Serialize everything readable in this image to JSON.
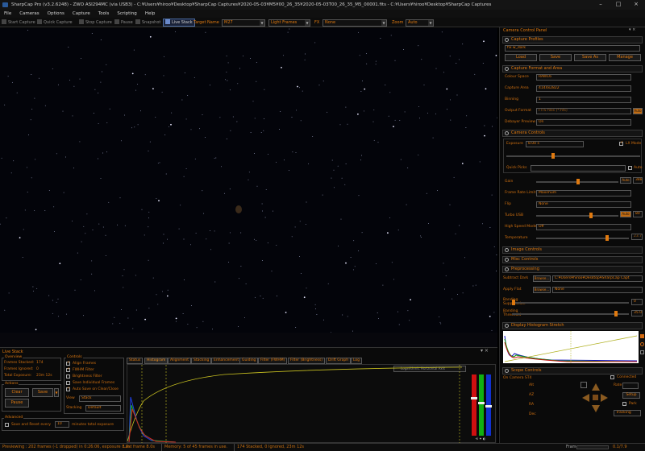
{
  "window": {
    "title": "SharpCap Pro (v3.2.6248) - ZWO ASI294MC (via USB3) - C:¥Users¥hiroo¥Desktop¥SharpCap Captures¥2020-05-03¥M5¥00_26_35¥2020-05-03T00_26_35_M5_00001.fits - C:¥Users¥hiroo¥Desktop¥SharpCap Captures"
  },
  "menu": [
    "File",
    "Cameras",
    "Options",
    "Capture",
    "Tools",
    "Scripting",
    "Help"
  ],
  "toolbar": {
    "start_capture": "Start Capture",
    "quick_capture": "Quick Capture",
    "stop_capture": "Stop Capture",
    "pause": "Pause",
    "snapshot": "Snapshot",
    "live_stack": "Live Stack",
    "target_name_label": "Target Name",
    "target_name_value": "M27",
    "frame_type": "Light Frames",
    "fx_label": "FX",
    "fx_value": "None",
    "zoom_label": "Zoom",
    "zoom_value": "Auto"
  },
  "panel": {
    "title": "Camera Control Panel",
    "capture_profiles": "Capture Profiles",
    "profile_value": "fix w_dark",
    "load": "Load",
    "save": "Save",
    "save_as": "Save As",
    "manage": "Manage",
    "capture_format": "Capture Format and Area",
    "colour_space_label": "Colour Space",
    "colour_space": "RAW16",
    "capture_area_label": "Capture Area",
    "capture_area": "4144x2822",
    "binning_label": "Binning",
    "binning": "1",
    "output_format_label": "Output Format",
    "output_format": "FITS files (*.fits)",
    "auto": "Auto",
    "debayer_label": "Debayer Preview",
    "debayer": "On",
    "camera_controls": "Camera Controls",
    "exposure_label": "Exposure",
    "exposure": "8.00 s",
    "lx_mode": "LX Mode",
    "quick_picks": "Quick Picks",
    "auto2": "Auto",
    "gain_label": "Gain",
    "gain_value": "388",
    "frame_rate_label": "Frame Rate Limit",
    "frame_rate": "Maximum",
    "flip_label": "Flip",
    "flip": "None",
    "turbo_label": "Turbo USB",
    "turbo_value": "80",
    "high_speed_label": "High Speed Mode",
    "high_speed": "Off",
    "temperature_label": "Temperature",
    "temperature": "23.7",
    "image_controls": "Image Controls",
    "misc_controls": "Misc Controls",
    "preprocessing": "Preprocessing",
    "subtract_dark_label": "Subtract Dark",
    "browse": "Browse...",
    "subtract_dark": "C:¥Users¥hiroo¥Desktop¥SharpCap Capt",
    "apply_flat_label": "Apply Flat",
    "apply_flat": "None",
    "banding_supp_label": "Banding Suppression",
    "banding_supp": "0",
    "banding_thr_label": "Banding Threshold",
    "banding_thr": "35.0",
    "histogram_stretch": "Display Histogram Stretch",
    "scope_controls": "Scope Controls",
    "scope_name": "On Camera ST4",
    "connected": "Connected",
    "alt": "Alt",
    "az": "AZ",
    "ra": "RA",
    "dec": "Dec",
    "rate_label": "Rate",
    "setup": "Setup",
    "park": "Park",
    "tracking": "Tracking"
  },
  "livestack": {
    "title": "Live Stack",
    "overview": "Overview",
    "frames_stacked_label": "Frames Stacked:",
    "frames_stacked": "174",
    "frames_ignored_label": "Frames Ignored:",
    "frames_ignored": "0",
    "total_exposure_label": "Total Exposure:",
    "total_exposure": "23m 12s",
    "actions": "Actions",
    "clear": "Clear",
    "save": "Save",
    "pause": "Pause",
    "controls": "Controls",
    "align_frames": "Align Frames",
    "fwhm_filter": "FWHM Filter",
    "brightness_filter": "Brightness Filter",
    "save_individual": "Save Individual Frames",
    "auto_save": "Auto Save on Clear/Close",
    "view_label": "View",
    "view": "Stack",
    "stacking_label": "Stacking",
    "stacking": "Default",
    "advanced": "Advanced",
    "save_reset": "Save and Reset every",
    "save_reset_value": "10",
    "minutes_total": "minutes total exposure",
    "tabs": [
      "Status",
      "Histogram",
      "Alignment",
      "Stacking",
      "Enhancement",
      "Guiding",
      "Filter (FWHM)",
      "Filter (Brightness)",
      "Drift Graph",
      "Log"
    ],
    "hist_options": "Logarithmic Horizontal Axis"
  },
  "status": {
    "previewing": "Previewing : 202 frames (-1 dropped) in 0:26:06, exposure 8.0s",
    "last_frame": "Last frame 8.0s",
    "memory": "Memory: 5 of 45 frames in use.",
    "stacked": "174 Stacked, 0 Ignored, 23m 12s",
    "frames_label": "Frame:",
    "frames_value": "0.1/7.9"
  },
  "colors": {
    "accent": "#e07a10",
    "background": "#0a0a0a"
  }
}
